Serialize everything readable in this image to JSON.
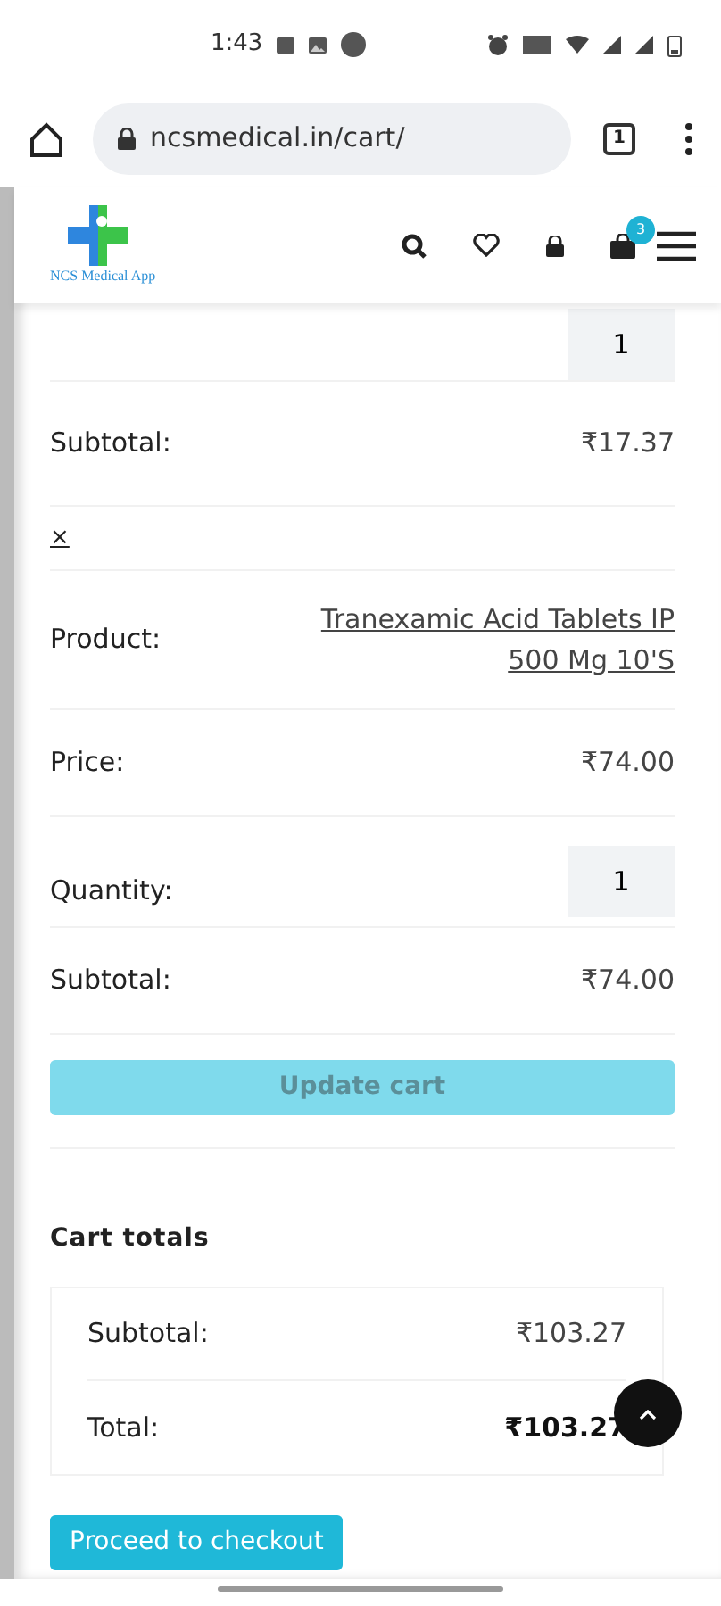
{
  "status_bar": {
    "time": "1:43"
  },
  "browser": {
    "url": "ncsmedical.in/cart/",
    "tab_count": "1"
  },
  "header": {
    "logo_text": "NCS Medical App",
    "cart_count": "3"
  },
  "cart_rows": [
    {
      "kind": "quantity",
      "value": "1"
    },
    {
      "kind": "field",
      "label": "Subtotal:",
      "value": "₹17.37"
    },
    {
      "kind": "remove",
      "value": "×"
    },
    {
      "kind": "link",
      "label": "Product:",
      "value": "Tranexamic Acid Tablets IP 500 Mg 10'S"
    },
    {
      "kind": "field",
      "label": "Price:",
      "value": "₹74.00"
    },
    {
      "kind": "quantity",
      "label": "Quantity:",
      "value": "1"
    },
    {
      "kind": "field",
      "label": "Subtotal:",
      "value": "₹74.00"
    }
  ],
  "update_button": {
    "label": "Update cart",
    "disabled": true
  },
  "cart_totals": {
    "title": "Cart totals",
    "rows": [
      {
        "label": "Subtotal:",
        "value": "₹103.27",
        "bold": false
      },
      {
        "label": "Total:",
        "value": "₹103.27",
        "bold": true
      }
    ],
    "checkout": "Proceed to checkout"
  }
}
